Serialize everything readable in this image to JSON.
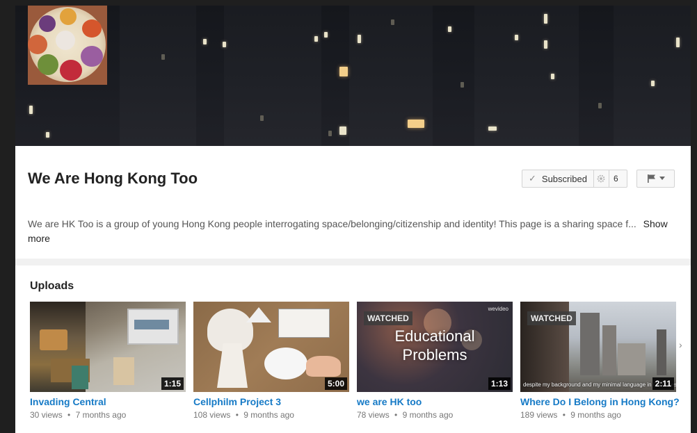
{
  "channel": {
    "title": "We Are Hong Kong Too",
    "description": "We are HK Too is a group of young Hong Kong people interrogating space/belonging/citizenship and identity! This page is a sharing space f...",
    "show_more": "Show more",
    "subscribe_label": "Subscribed",
    "subscriber_count": "6",
    "icons": {
      "subscribe": "check-icon",
      "settings": "gear-icon",
      "flag": "flag-icon",
      "dropdown": "chevron-down-icon"
    }
  },
  "uploads": {
    "title": "Uploads",
    "videos": [
      {
        "title": "Invading Central",
        "views": "30 views",
        "age": "7 months ago",
        "duration": "1:15",
        "watched": ""
      },
      {
        "title": "Cellphilm Project 3",
        "views": "108 views",
        "age": "9 months ago",
        "duration": "5:00",
        "watched": ""
      },
      {
        "title": "we are HK too",
        "views": "78 views",
        "age": "9 months ago",
        "duration": "1:13",
        "watched": "WATCHED",
        "overlay_line1": "Educational",
        "overlay_line2": "Problems",
        "brand": "wevideo"
      },
      {
        "title": "Where Do I Belong in Hong Kong?",
        "views": "189 views",
        "age": "9 months ago",
        "duration": "2:11",
        "watched": "WATCHED",
        "caption": "despite my background and my minimal language in Cantonese."
      }
    ],
    "separator": "•"
  },
  "colors": {
    "link": "#167ac6",
    "background": "#f1f1f1",
    "card": "#ffffff"
  }
}
